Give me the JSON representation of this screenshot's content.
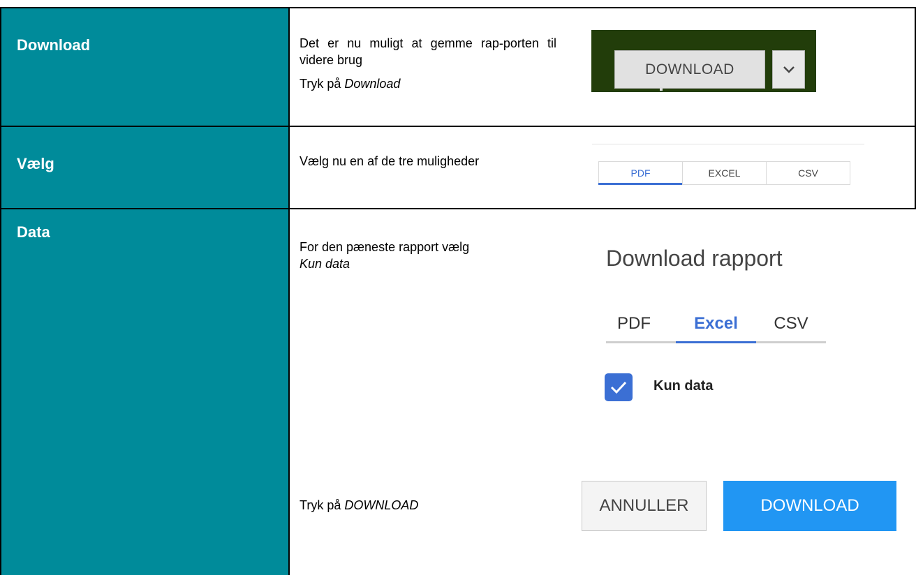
{
  "rows": [
    {
      "label": "Download",
      "lines": [
        "Det er nu muligt at gemme rap-porten til videre brug"
      ],
      "action_prefix": "Tryk på ",
      "action_italic": "Download",
      "shot": {
        "button_label": "DOWNLOAD",
        "dropdown_icon": "chevron-down-icon"
      }
    },
    {
      "label": "Vælg",
      "lines": [
        "Vælg nu en af de tre muligheder"
      ],
      "shot": {
        "tabs": [
          "PDF",
          "EXCEL",
          "CSV"
        ],
        "active": "PDF"
      }
    },
    {
      "label": "Data",
      "intro": "For den pæneste rapport vælg ",
      "intro_italic": "Kun data",
      "action_prefix": "Tryk på ",
      "action_italic": "DOWNLOAD",
      "shot": {
        "title": "Download rapport",
        "tabs": [
          "PDF",
          "Excel",
          "CSV"
        ],
        "active": "Excel",
        "checkbox_label": "Kun data",
        "checkbox_checked": true,
        "cancel_label": "ANNULLER",
        "download_label": "DOWNLOAD"
      }
    }
  ],
  "colors": {
    "label_bg": "#008B9A",
    "accent": "#3b6fd4",
    "download_button": "#2196f3",
    "shot1_bg": "#223d0a"
  }
}
